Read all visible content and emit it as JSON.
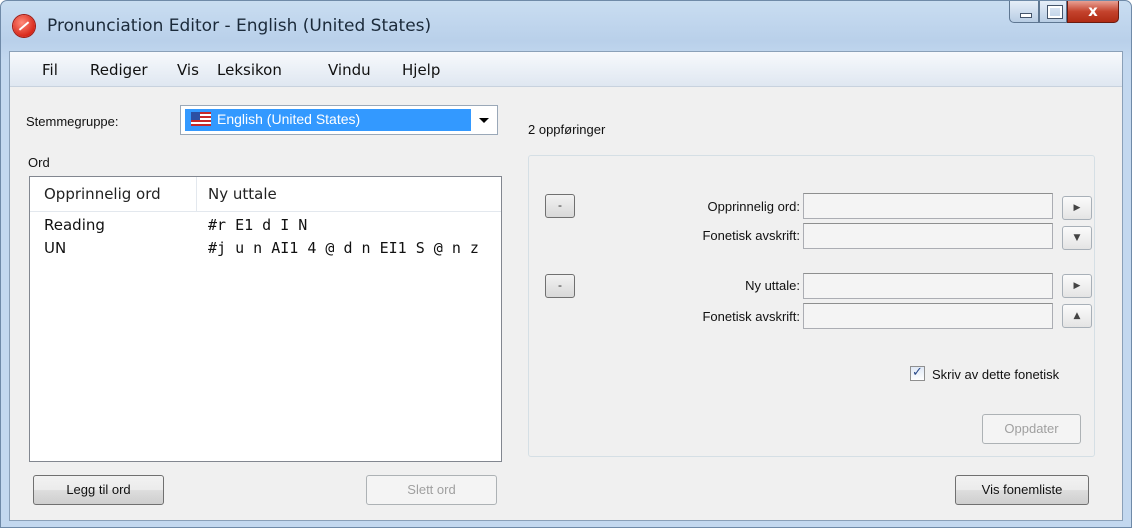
{
  "window": {
    "title": "Pronunciation Editor - English (United States)",
    "icon": "app-icon",
    "controls": {
      "minimize": "minimize-icon",
      "maximize": "maximize-icon",
      "close": "x"
    }
  },
  "menu": [
    "Fil",
    "Rediger",
    "Vis",
    "Leksikon",
    "Vindu",
    "Hjelp"
  ],
  "voice_group": {
    "label": "Stemmegruppe:",
    "value": "English (United States)",
    "flag_icon": "us-flag-icon"
  },
  "entries_count": "2 oppføringer",
  "words": {
    "label": "Ord",
    "columns": [
      "Opprinnelig ord",
      "Ny uttale"
    ],
    "rows": [
      {
        "word": "Reading",
        "pronunciation": "#r E1 d I N"
      },
      {
        "word": "UN",
        "pronunciation": "#j u n AI1 4 @ d n EI1 S @ n z"
      }
    ]
  },
  "editor": {
    "original_word_label": "Opprinnelig ord:",
    "phonetic_label_1": "Fonetisk avskrift:",
    "new_pronunciation_label": "Ny uttale:",
    "phonetic_label_2": "Fonetisk avskrift:",
    "original_word_value": "",
    "phonetic_value_1": "",
    "new_pronunciation_value": "",
    "phonetic_value_2": "",
    "dash_button_1": "-",
    "dash_button_2": "-",
    "play_icon": "▶",
    "down_icon": "▼",
    "up_icon": "▲",
    "transcribe_checkbox_label": "Skriv av dette fonetisk",
    "transcribe_checked": true,
    "checkmark": "✓",
    "update_button": "Oppdater"
  },
  "buttons": {
    "add_word": "Legg til ord",
    "delete_word": "Slett ord",
    "show_phonemes": "Vis fonemliste"
  }
}
